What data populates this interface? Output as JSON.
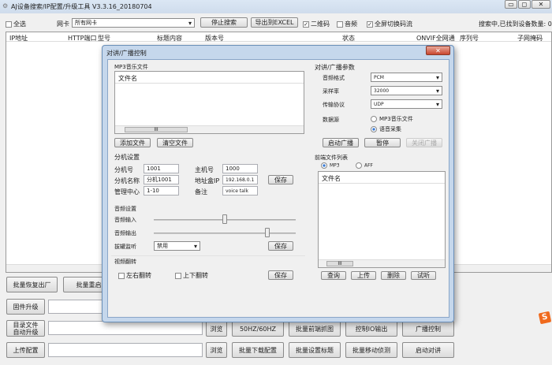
{
  "window": {
    "title": "AJ设备搜索/IP配置/升级工具 V3.3.16_20180704"
  },
  "toolbar": {
    "select_all": "全选",
    "nic_label": "网卡",
    "nic_value": "所有网卡",
    "stop_search": "停止搜索",
    "export_excel": "导出到EXCEL",
    "qrcode": "二维码",
    "audio": "音频",
    "fullscreen_stream": "全屏切换码流",
    "status": "搜索中,已找到设备数量: 0"
  },
  "table": {
    "columns": [
      "IP地址",
      "HTTP端口",
      "型号",
      "标题内容",
      "版本号",
      "状态",
      "ONVIF全网通",
      "序列号",
      "子网掩码"
    ]
  },
  "bottom": {
    "factory_reset": "批量恢复出厂",
    "batch_reboot": "批量重启",
    "firmware_upgrade": "固件升级",
    "dir_upgrade": "目录文件自动升级",
    "upload_config": "上传配置",
    "browse": "浏览",
    "hz": "50HZ/60HZ",
    "batch_snapshot": "批量前端抓图",
    "io_output": "控制IO输出",
    "broadcast_control": "广播控制",
    "batch_download_config": "批量下载配置",
    "batch_set_title": "批量设置标题",
    "batch_motion": "批量移动侦测",
    "start_talk": "启动对讲"
  },
  "dialog": {
    "title": "对讲/广播控制",
    "mp3": {
      "group": "MP3音乐文件",
      "col": "文件名",
      "add": "添加文件",
      "clear": "清空文件"
    },
    "ext": {
      "group": "分机设置",
      "ext_no_label": "分机号",
      "ext_no": "1001",
      "host_no_label": "主机号",
      "host_no": "1000",
      "ext_name_label": "分机名称",
      "ext_name": "分机1001",
      "host_ip_label": "地址盒IP",
      "host_ip": "192.168.0.1",
      "center_label": "管理中心",
      "center": "1-10",
      "note_label": "备注",
      "note": "voice talk",
      "save": "保存"
    },
    "audio": {
      "group": "音频设置",
      "input": "音频输入",
      "output": "音频输出",
      "input_level": 0.5,
      "output_level": 0.8,
      "monitor_label": "拔罐监听",
      "monitor_value": "禁用",
      "save": "保存"
    },
    "video": {
      "group": "视频翻转",
      "lr": "左右翻转",
      "ud": "上下翻转",
      "save": "保存"
    },
    "params": {
      "group": "对讲/广播参数",
      "format_label": "音频格式",
      "format": "PCM",
      "rate_label": "采样率",
      "rate": "32000",
      "proto_label": "传输协议",
      "proto": "UDP",
      "source_label": "数据源",
      "src_mp3": "MP3音乐文件",
      "src_voice": "语音采集",
      "start": "启动广播",
      "pause": "暂停",
      "stop": "关闭广播"
    },
    "remote": {
      "group": "前端文件列表",
      "mp3": "MP3",
      "aff": "AFF",
      "col": "文件名",
      "query": "查询",
      "upload": "上传",
      "delete": "删除",
      "listen": "试听"
    }
  }
}
